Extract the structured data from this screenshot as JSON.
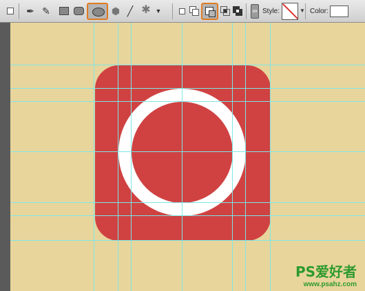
{
  "toolbar": {
    "tools": [
      {
        "name": "shape-layers"
      },
      {
        "name": "paths"
      },
      {
        "name": "pen"
      },
      {
        "name": "freeform-pen"
      },
      {
        "name": "rectangle"
      },
      {
        "name": "rounded-rectangle"
      },
      {
        "name": "ellipse",
        "selected": true
      },
      {
        "name": "polygon"
      },
      {
        "name": "line"
      },
      {
        "name": "custom-shape"
      }
    ],
    "modes": [
      {
        "name": "new-layer"
      },
      {
        "name": "add-to-shape-area"
      },
      {
        "name": "subtract-from-shape-area",
        "selected": true
      },
      {
        "name": "intersect-shape-areas"
      },
      {
        "name": "exclude-overlapping-shape-areas"
      }
    ],
    "style_label": "Style:",
    "color_label": "Color:",
    "color_value": "#ffffff"
  },
  "canvas": {
    "background": "#e8d59c",
    "icon_color": "#d04242",
    "ring_color": "#ffffff",
    "guide_color": "#7ee6e6"
  },
  "watermark": {
    "logo": "PS爱好者",
    "url": "www.psahz.com"
  }
}
